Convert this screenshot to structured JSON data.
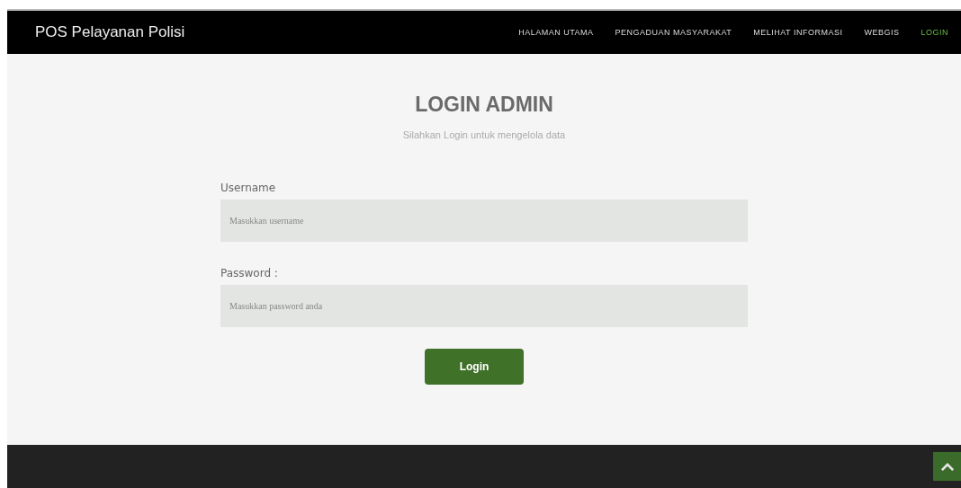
{
  "navbar": {
    "brand": "POS Pelayanan Polisi",
    "items": [
      {
        "label": "HALAMAN UTAMA",
        "selected": false
      },
      {
        "label": "PENGADUAN MASYARAKAT",
        "selected": false
      },
      {
        "label": "MELIHAT INFORMASI",
        "selected": false
      },
      {
        "label": "WEBGIS",
        "selected": false
      },
      {
        "label": "LOGIN",
        "selected": true
      }
    ]
  },
  "login": {
    "title": "LOGIN ADMIN",
    "subtitle": "Silahkan Login untuk mengelola data",
    "fields": [
      {
        "label": "Username",
        "placeholder": "Masukkan username"
      },
      {
        "label": "Password :",
        "placeholder": "Masukkan password anda"
      }
    ],
    "button": "Login"
  }
}
